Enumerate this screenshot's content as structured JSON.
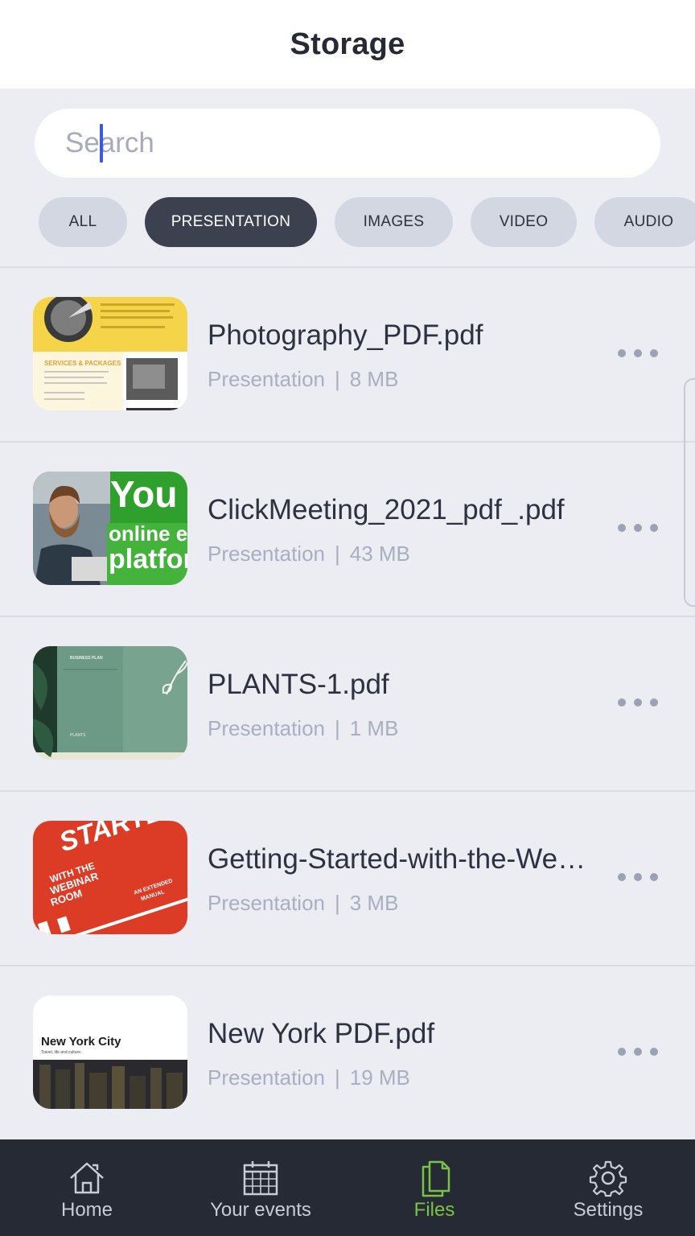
{
  "header": {
    "title": "Storage"
  },
  "search": {
    "placeholder": "Search",
    "value": ""
  },
  "filters": [
    {
      "label": "ALL",
      "active": false
    },
    {
      "label": "PRESENTATION",
      "active": true
    },
    {
      "label": "IMAGES",
      "active": false
    },
    {
      "label": "VIDEO",
      "active": false
    },
    {
      "label": "AUDIO",
      "active": false
    }
  ],
  "files": [
    {
      "name": "Photography_PDF.pdf",
      "type": "Presentation",
      "size": "8 MB"
    },
    {
      "name": "ClickMeeting_2021_pdf_.pdf",
      "type": "Presentation",
      "size": "43 MB"
    },
    {
      "name": "PLANTS-1.pdf",
      "type": "Presentation",
      "size": "1 MB"
    },
    {
      "name": "Getting-Started-with-the-Webinar-Room.pdf",
      "type": "Presentation",
      "size": "3 MB"
    },
    {
      "name": "New York PDF.pdf",
      "type": "Presentation",
      "size": "19 MB"
    }
  ],
  "meta_separator": "|",
  "thumb_text": {
    "photo_heading": "SERVICES & PACKAGES",
    "click_lines": [
      "You",
      "online eve",
      "platfor"
    ],
    "plants_heading": "BUSINESS PLAN",
    "plants_sub": "PLANTS",
    "started_big": "STARTED",
    "started_with": "WITH THE",
    "started_webinar": "WEBINAR",
    "started_room": "ROOM",
    "started_an": "AN EXTENDED",
    "started_manual": "MANUAL",
    "ny_title": "New York City",
    "ny_sub": "Travel, life and culture."
  },
  "tabs": [
    {
      "label": "Home",
      "icon": "home-icon",
      "active": false
    },
    {
      "label": "Your events",
      "icon": "calendar-icon",
      "active": false
    },
    {
      "label": "Files",
      "icon": "file-icon",
      "active": true
    },
    {
      "label": "Settings",
      "icon": "gear-icon",
      "active": false
    }
  ],
  "colors": {
    "accent": "#7bc143",
    "chip_active": "#3c4150",
    "chip": "#d3d7e2",
    "tabbar": "#262a35",
    "background": "#ebedf3"
  }
}
